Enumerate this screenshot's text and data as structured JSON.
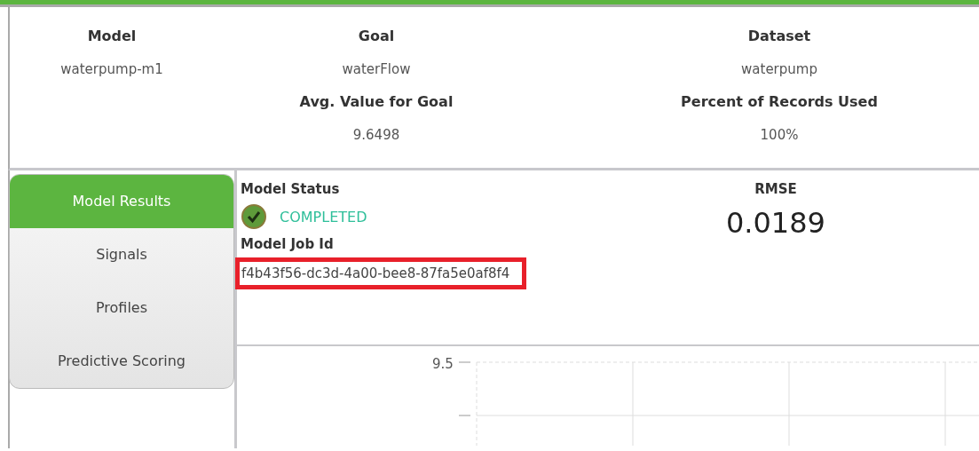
{
  "summary": [
    {
      "label": "Model",
      "value": "waterpump-m1"
    },
    {
      "label": "Goal",
      "value": "waterFlow",
      "sub_label": "Avg. Value for Goal",
      "sub_value": "9.6498"
    },
    {
      "label": "Dataset",
      "value": "waterpump",
      "sub_label": "Percent of Records Used",
      "sub_value": "100%"
    }
  ],
  "nav": [
    {
      "label": "Model Results",
      "selected": true
    },
    {
      "label": "Signals",
      "selected": false
    },
    {
      "label": "Profiles",
      "selected": false
    },
    {
      "label": "Predictive Scoring",
      "selected": false
    }
  ],
  "status": {
    "label": "Model Status",
    "value": "COMPLETED",
    "completed": true
  },
  "job": {
    "label": "Model Job Id",
    "value": "f4b43f56-dc3d-4a00-bee8-87fa5e0af8f4",
    "highlighted": true
  },
  "rmse": {
    "label": "RMSE",
    "value": "0.0189"
  },
  "chart": {
    "y_tick_label": "9.5"
  }
}
